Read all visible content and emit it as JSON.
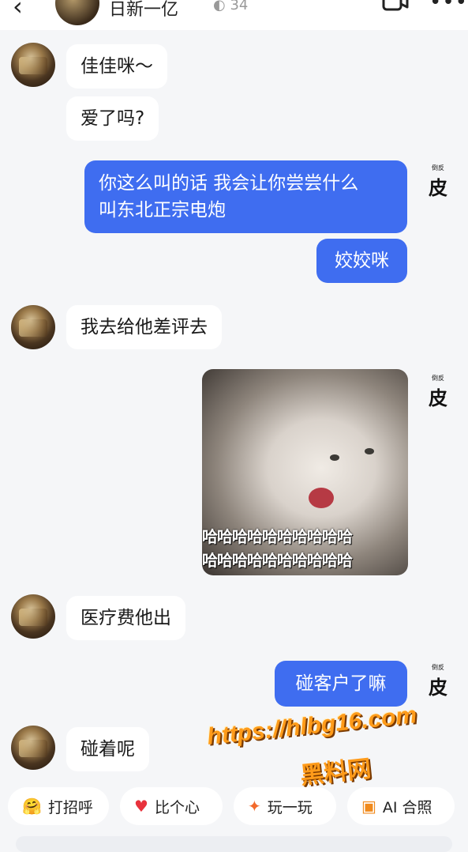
{
  "header": {
    "back_icon": "chevron-left-icon",
    "title": "日新一亿",
    "count": "34",
    "video_icon": "video-call-icon",
    "more_icon": "more-icon"
  },
  "messages": [
    {
      "side": "left",
      "text": "佳佳咪～"
    },
    {
      "side": "left",
      "text": "爱了吗?"
    },
    {
      "side": "right",
      "line1": "你这么叫的话 我会让你尝尝什么",
      "line2": "叫东北正宗电炮"
    },
    {
      "side": "right",
      "text": "姣姣咪"
    },
    {
      "side": "left",
      "text": "我去给他差评去"
    },
    {
      "side": "right",
      "image_caption_row1": "哈哈哈哈哈哈哈哈哈哈",
      "image_caption_row2": "哈哈哈哈哈哈哈哈哈哈"
    },
    {
      "side": "left",
      "text": "医疗费他出"
    },
    {
      "side": "right",
      "text": "碰客户了嘛"
    },
    {
      "side": "left",
      "text": "碰着呢"
    }
  ],
  "self_avatar_glyph": "皮",
  "self_avatar_small": "倒反",
  "watermark": {
    "url": "https://hlbg16.com",
    "text": "黑料网"
  },
  "quick_actions": [
    {
      "label": "打招呼",
      "icon": "wave-emoji-icon"
    },
    {
      "label": "比个心",
      "icon": "heart-icon"
    },
    {
      "label": "玩一玩",
      "icon": "sparkle-icon"
    },
    {
      "label": "AI 合照",
      "icon": "ai-photo-icon"
    }
  ],
  "colors": {
    "accent": "#3f6df0",
    "bubble_left": "#ffffff",
    "background": "#f5f6f8"
  }
}
